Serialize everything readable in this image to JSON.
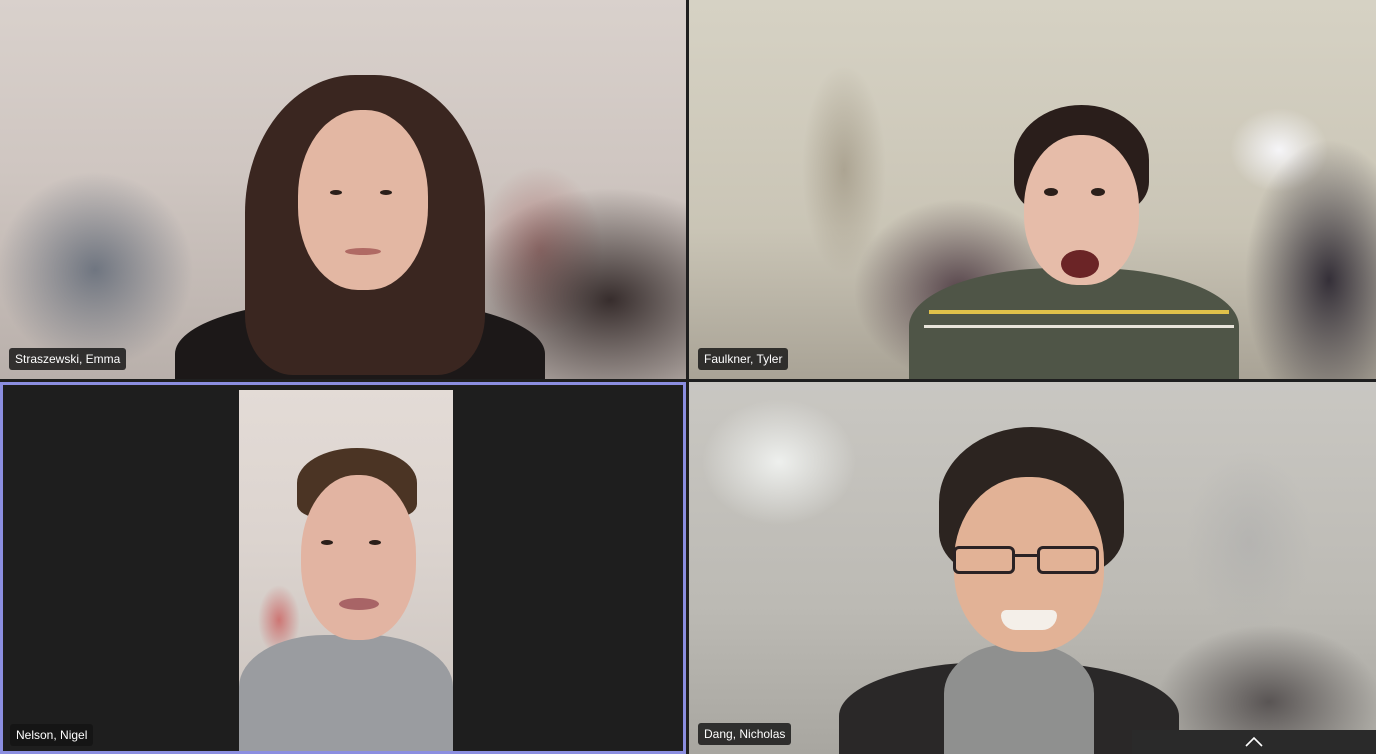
{
  "participants": [
    {
      "name": "Straszewski, Emma"
    },
    {
      "name": "Faulkner, Tyler"
    },
    {
      "name": "Nelson, Nigel"
    },
    {
      "name": "Dang, Nicholas"
    }
  ],
  "active_speaker_index": 2,
  "colors": {
    "active_border": "#8b8ee0",
    "background": "#1f1f1f",
    "name_tag_bg": "#141414"
  },
  "controls": {
    "expand_icon": "chevron-up-icon"
  }
}
